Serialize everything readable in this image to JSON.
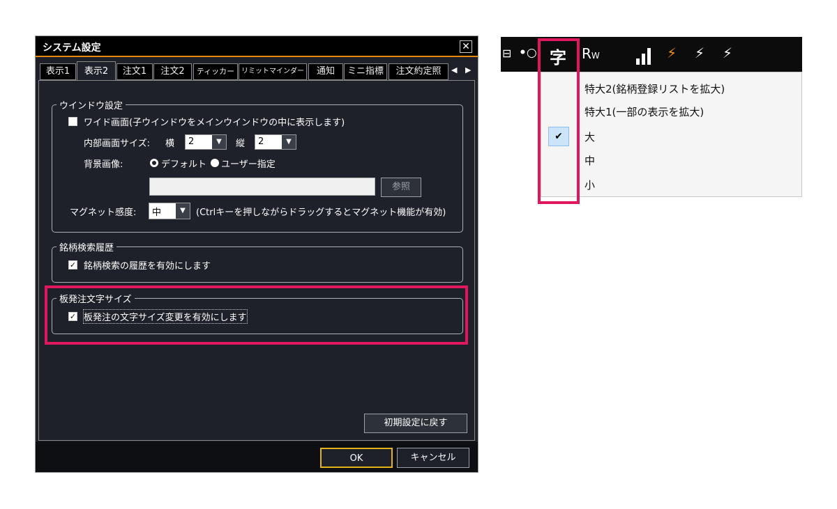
{
  "dialog": {
    "title": "システム設定",
    "close_label": "✕",
    "tabs": [
      {
        "label": "表示1"
      },
      {
        "label": "表示2"
      },
      {
        "label": "注文1"
      },
      {
        "label": "注文2"
      },
      {
        "label": "ティッカー"
      },
      {
        "label": "リミットマインダー"
      },
      {
        "label": "通知"
      },
      {
        "label": "ミニ指標"
      },
      {
        "label": "注文約定照"
      }
    ],
    "tab_arrows": {
      "left": "◀",
      "right": "▶"
    },
    "window_settings": {
      "title": "ウインドウ設定",
      "wide_label": "ワイド画面(子ウインドウをメインウインドウの中に表示します)",
      "inner_size_label": "内部画面サイズ:",
      "horizontal_label": "横",
      "horizontal_value": "2",
      "vertical_label": "縦",
      "vertical_value": "2",
      "bg_image_label": "背景画像:",
      "radio_default": "デフォルト",
      "radio_user": "ユーザー指定",
      "browse_label": "参照",
      "magnet_label": "マグネット感度:",
      "magnet_value": "中",
      "magnet_note": "(Ctrlキーを押しながらドラッグするとマグネット機能が有効)"
    },
    "search_history": {
      "title": "銘柄検索履歴",
      "enable_label": "銘柄検索の履歴を有効にします"
    },
    "font_size": {
      "title": "板発注文字サイズ",
      "enable_label": "板発注の文字サイズ変更を有効にします"
    },
    "reset_label": "初期設定に戻す",
    "ok_label": "OK",
    "cancel_label": "キャンセル"
  },
  "toolbar": {
    "font_icon_label": "字",
    "rw_label": "R",
    "rw_sub": "W",
    "bolt": "⚡"
  },
  "menu": {
    "items": [
      {
        "label": "特大2(銘柄登録リストを拡大)"
      },
      {
        "label": "特大1(一部の表示を拡大)"
      },
      {
        "label": "大"
      },
      {
        "label": "中"
      },
      {
        "label": "小"
      }
    ],
    "selected_index": 2,
    "check_mark": "✔"
  },
  "colors": {
    "accent_orange": "#e6890f",
    "highlight_pink": "#e0165f",
    "dialog_bg": "#1e2129"
  }
}
